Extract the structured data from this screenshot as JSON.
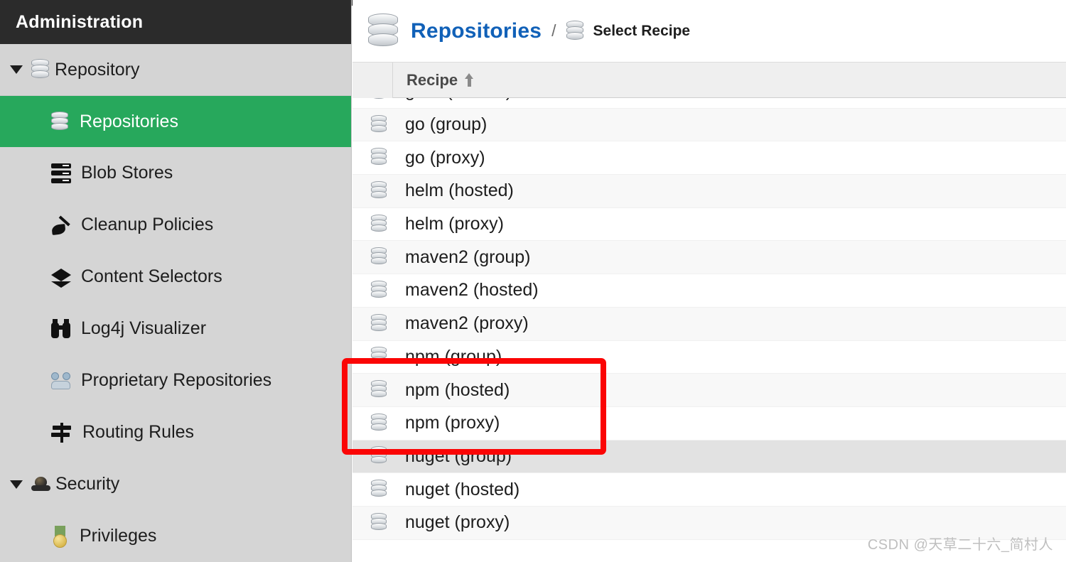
{
  "colors": {
    "accent_green": "#27a85c",
    "sidebar_bg": "#d5d5d5",
    "sidebar_header_bg": "#2b2b2b",
    "link_blue": "#1161b8",
    "annotation_red": "#fb0505",
    "row_alt": "#f8f8f8",
    "row_hover": "#e2e2e2",
    "table_header_bg": "#efefef"
  },
  "sidebar": {
    "title": "Administration",
    "groups": [
      {
        "label": "Repository",
        "icon": "database-icon",
        "expanded": true,
        "items": [
          {
            "label": "Repositories",
            "icon": "database-icon",
            "selected": true
          },
          {
            "label": "Blob Stores",
            "icon": "server-stack-icon",
            "selected": false
          },
          {
            "label": "Cleanup Policies",
            "icon": "broom-icon",
            "selected": false
          },
          {
            "label": "Content Selectors",
            "icon": "layers-icon",
            "selected": false
          },
          {
            "label": "Log4j Visualizer",
            "icon": "binoculars-icon",
            "selected": false
          },
          {
            "label": "Proprietary Repositories",
            "icon": "people-icon",
            "selected": false
          },
          {
            "label": "Routing Rules",
            "icon": "signpost-icon",
            "selected": false
          }
        ]
      },
      {
        "label": "Security",
        "icon": "shield-icon",
        "expanded": true,
        "items": [
          {
            "label": "Privileges",
            "icon": "medal-icon",
            "selected": false
          }
        ]
      }
    ]
  },
  "main": {
    "breadcrumb": {
      "root_icon": "database-icon",
      "root_label": "Repositories",
      "separator": "/",
      "current_icon": "database-icon",
      "current_label": "Select Recipe"
    },
    "table": {
      "columns": [
        {
          "label": "",
          "kind": "checkbox"
        },
        {
          "label": "Recipe",
          "kind": "text",
          "sort": "asc",
          "sort_icon": "sort-ascending-icon"
        }
      ],
      "rows": [
        {
          "label": "gitlfs (hosted)",
          "icon": "database-icon",
          "highlighted": false,
          "hovered": false
        },
        {
          "label": "go (group)",
          "icon": "database-icon",
          "highlighted": false,
          "hovered": false
        },
        {
          "label": "go (proxy)",
          "icon": "database-icon",
          "highlighted": false,
          "hovered": false
        },
        {
          "label": "helm (hosted)",
          "icon": "database-icon",
          "highlighted": false,
          "hovered": false
        },
        {
          "label": "helm (proxy)",
          "icon": "database-icon",
          "highlighted": false,
          "hovered": false
        },
        {
          "label": "maven2 (group)",
          "icon": "database-icon",
          "highlighted": false,
          "hovered": false
        },
        {
          "label": "maven2 (hosted)",
          "icon": "database-icon",
          "highlighted": false,
          "hovered": false
        },
        {
          "label": "maven2 (proxy)",
          "icon": "database-icon",
          "highlighted": false,
          "hovered": false
        },
        {
          "label": "npm (group)",
          "icon": "database-icon",
          "highlighted": true,
          "hovered": false
        },
        {
          "label": "npm (hosted)",
          "icon": "database-icon",
          "highlighted": true,
          "hovered": false
        },
        {
          "label": "npm (proxy)",
          "icon": "database-icon",
          "highlighted": true,
          "hovered": false
        },
        {
          "label": "nuget (group)",
          "icon": "database-icon",
          "highlighted": false,
          "hovered": true
        },
        {
          "label": "nuget (hosted)",
          "icon": "database-icon",
          "highlighted": false,
          "hovered": false
        },
        {
          "label": "nuget (proxy)",
          "icon": "database-icon",
          "highlighted": false,
          "hovered": false
        }
      ]
    }
  },
  "watermark": {
    "text": "CSDN @天草二十六_简村人"
  }
}
